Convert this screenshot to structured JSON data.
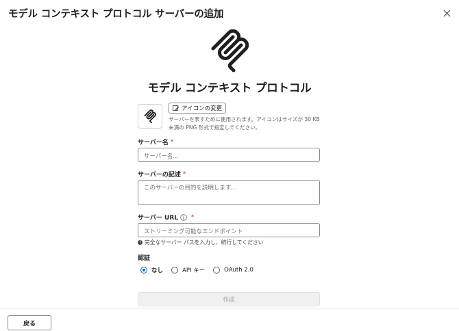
{
  "dialog": {
    "title": "モデル コンテキスト プロトコル サーバーの追加",
    "close_icon": "close-icon"
  },
  "hero": {
    "icon": "mcp-logo-icon",
    "title": "モデル コンテキスト プロトコル"
  },
  "icon_section": {
    "change_label": "アイコンの変更",
    "hint": "サーバーを表すために使用されます。アイコンはサイズが 30 KB 未満の PNG 形式で指定してください。"
  },
  "server_name": {
    "label": "サーバー名",
    "required_mark": "*",
    "placeholder": "サーバー名..."
  },
  "server_description": {
    "label": "サーバーの記述",
    "required_mark": "*",
    "placeholder": "このサーバーの目的を説明します..."
  },
  "server_url": {
    "label": "サーバー URL",
    "info_icon": "info-icon",
    "required_mark": "*",
    "placeholder": "ストリーミング可能なエンドポイント",
    "hint": "完全なサーバー パスを入力し、続行してください"
  },
  "auth": {
    "label": "認証",
    "options": [
      {
        "label": "なし",
        "selected": true
      },
      {
        "label": "API キー",
        "selected": false
      },
      {
        "label": "OAuth 2.0",
        "selected": false
      }
    ]
  },
  "create_label": "作成",
  "back_label": "戻る",
  "colors": {
    "accent": "#0f6cbd",
    "required": "#c4314b",
    "disabled_bg": "#f0f0f0"
  }
}
